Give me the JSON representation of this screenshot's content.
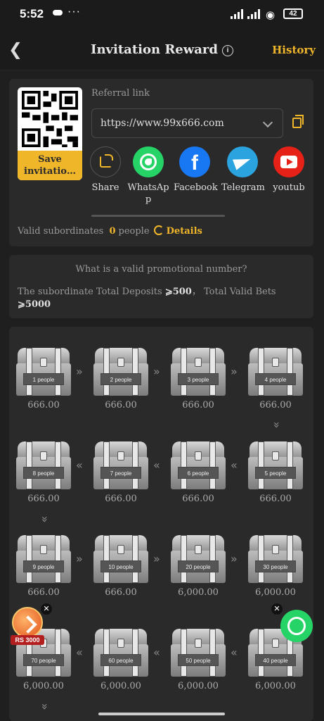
{
  "status": {
    "time": "5:52",
    "dots": "···",
    "battery": "42"
  },
  "header": {
    "title": "Invitation Reward",
    "info_icon": "i",
    "history": "History"
  },
  "referral": {
    "save_label": "Save invitatio…",
    "link_label": "Referral link",
    "link_value": "https://www.99x666.com",
    "share_items": [
      {
        "label": "Share",
        "icon": "share-icon",
        "color": "#2a2a2a"
      },
      {
        "label": "WhatsAp p",
        "icon": "whatsapp-icon",
        "color": "#25d366"
      },
      {
        "label": "Facebook",
        "icon": "facebook-icon",
        "color": "#1877f2"
      },
      {
        "label": "Telegram",
        "icon": "telegram-icon",
        "color": "#2aa3df"
      },
      {
        "label": "youtub",
        "icon": "youtube-icon",
        "color": "#e62117"
      }
    ],
    "valid_prefix": "Valid subordinates",
    "valid_count": "0",
    "valid_suffix": "people",
    "details": "Details"
  },
  "promo": {
    "question": "What is a valid promotional number?",
    "desc_a": "The subordinate Total Deposits ",
    "desc_b": "⩾500",
    "desc_c": "， Total Valid Bets ",
    "desc_d": "⩾5000"
  },
  "rewards": [
    {
      "label": "1 people",
      "amount": "666.00"
    },
    {
      "label": "2 people",
      "amount": "666.00"
    },
    {
      "label": "3 people",
      "amount": "666.00"
    },
    {
      "label": "4 people",
      "amount": "666.00"
    },
    {
      "label": "5 people",
      "amount": "666.00"
    },
    {
      "label": "6 people",
      "amount": "666.00"
    },
    {
      "label": "7 people",
      "amount": "666.00"
    },
    {
      "label": "8 people",
      "amount": "666.00"
    },
    {
      "label": "9 people",
      "amount": "666.00"
    },
    {
      "label": "10 people",
      "amount": "666.00"
    },
    {
      "label": "20 people",
      "amount": "6,000.00"
    },
    {
      "label": "30 people",
      "amount": "6,000.00"
    },
    {
      "label": "40 people",
      "amount": "6,000.00"
    },
    {
      "label": "50 people",
      "amount": "6,000.00"
    },
    {
      "label": "60 people",
      "amount": "6,000.00"
    },
    {
      "label": "70 people",
      "amount": "6,000.00"
    }
  ],
  "floating": {
    "promo_tag": "RS 3000",
    "close": "✕"
  },
  "colors": {
    "accent": "#f0b62a",
    "card": "#2a2a2a",
    "background": "#1f1f1f"
  }
}
